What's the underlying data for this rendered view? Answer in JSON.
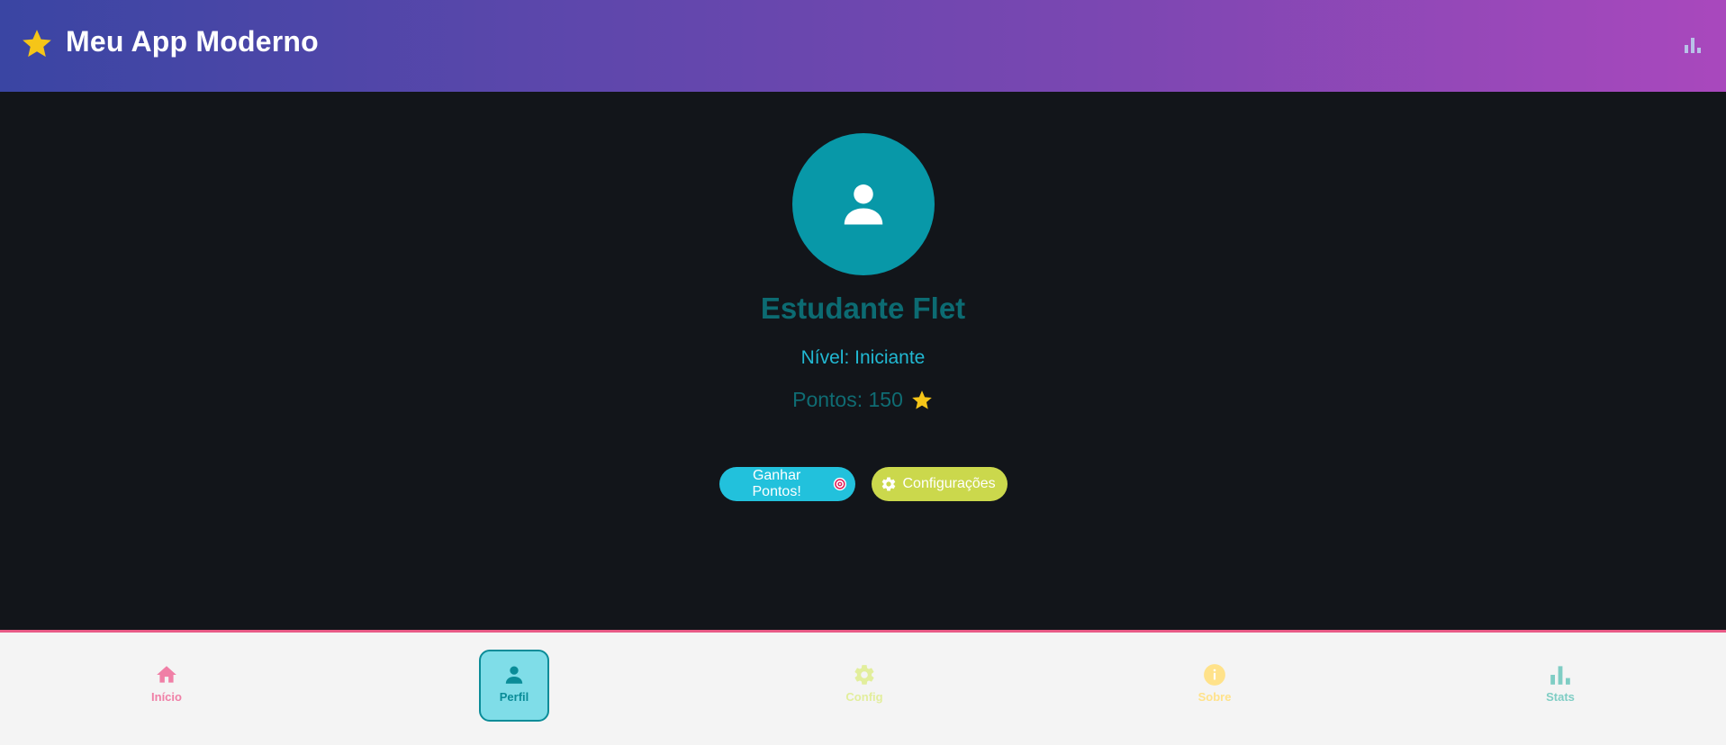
{
  "header": {
    "title": "Meu App Moderno",
    "title_icon": "star-icon",
    "action_icon": "bar-chart-icon"
  },
  "profile": {
    "avatar_icon": "person-icon",
    "name": "Estudante Flet",
    "level": "Nível: Iniciante",
    "points": "Pontos: 150",
    "points_icon": "star-icon"
  },
  "actions": {
    "earn_label": "Ganhar Pontos!",
    "earn_icon": "target-icon",
    "config_label": "Configurações",
    "config_icon": "gear-icon"
  },
  "nav": {
    "items": [
      {
        "label": "Início",
        "icon": "home-icon",
        "color": "#f07fa6",
        "active": false
      },
      {
        "label": "Perfil",
        "icon": "person-icon",
        "color": "#0a8c98",
        "active": true
      },
      {
        "label": "Config",
        "icon": "gear-icon",
        "color": "#e2ee9c",
        "active": false
      },
      {
        "label": "Sobre",
        "icon": "info-icon",
        "color": "#ffe28a",
        "active": false
      },
      {
        "label": "Stats",
        "icon": "bar-chart-icon",
        "color": "#7fcdc4",
        "active": false
      }
    ]
  },
  "colors": {
    "header_gradient_start": "#3a45a3",
    "header_gradient_end": "#a948bd",
    "background": "#12151a",
    "avatar_bg": "#0898a8",
    "earn_button": "#22c1dc",
    "config_button": "#cbd84c",
    "nav_border": "#e85a86"
  }
}
